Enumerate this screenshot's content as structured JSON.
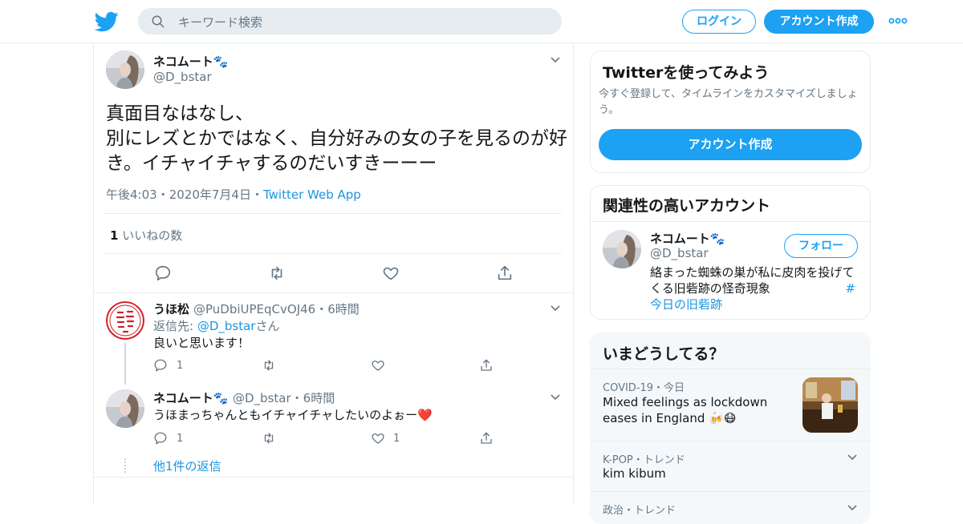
{
  "header": {
    "search_placeholder": "キーワード検索",
    "login_label": "ログイン",
    "signup_label": "アカウント作成"
  },
  "tweet": {
    "name": "ネコムート🐾",
    "handle": "@D_bstar",
    "text": "真面目なはなし、\n別にレズとかではなく、自分好みの女の子を見るのが好き。イチャイチャするのだいすきーーー",
    "time": "午後4:03",
    "date": "2020年7月4日",
    "source": "Twitter Web App",
    "like_count": "1",
    "like_label": "いいねの数"
  },
  "replies": [
    {
      "name": "うほ松",
      "handle": "@PuDbiUPEqCvOJ46",
      "time": "6時間",
      "reply_to_prefix": "返信先: ",
      "reply_to_handle": "@D_bstar",
      "reply_to_suffix": "さん",
      "text": "良いと思います！",
      "reply_count": "1",
      "like_count": ""
    },
    {
      "name": "ネコムート🐾",
      "handle": "@D_bstar",
      "time": "6時間",
      "text": "うほまっちゃんともイチャイチャしたいのよぉー❤️",
      "reply_count": "1",
      "like_count": "1"
    }
  ],
  "more_replies_label": "他1件の返信",
  "signup_card": {
    "title": "Twitterを使ってみよう",
    "desc": "今すぐ登録して、タイムラインをカスタマイズしましょう。",
    "button": "アカウント作成"
  },
  "related_card": {
    "title": "関連性の高いアカウント",
    "name": "ネコムート🐾",
    "handle": "@D_bstar",
    "follow_label": "フォロー",
    "bio_line1": "絡まった蜘蛛の巣が私に皮肉を投げて",
    "bio_line2": "くる旧砦跡の怪奇現象",
    "bio_hash": "#",
    "bio_link": "今日の旧砦跡"
  },
  "trends_card": {
    "title": "いまどうしてる？",
    "items": [
      {
        "context": "COVID-19・今日",
        "title": "Mixed feelings as lockdown eases in England 🍻😷"
      },
      {
        "context": "K-POP・トレンド",
        "title": "kim kibum"
      },
      {
        "context": "政治・トレンド",
        "title": ""
      }
    ]
  },
  "colors": {
    "brand": "#1da1f2",
    "link": "#1b95e0",
    "heart": "#c0143c"
  }
}
